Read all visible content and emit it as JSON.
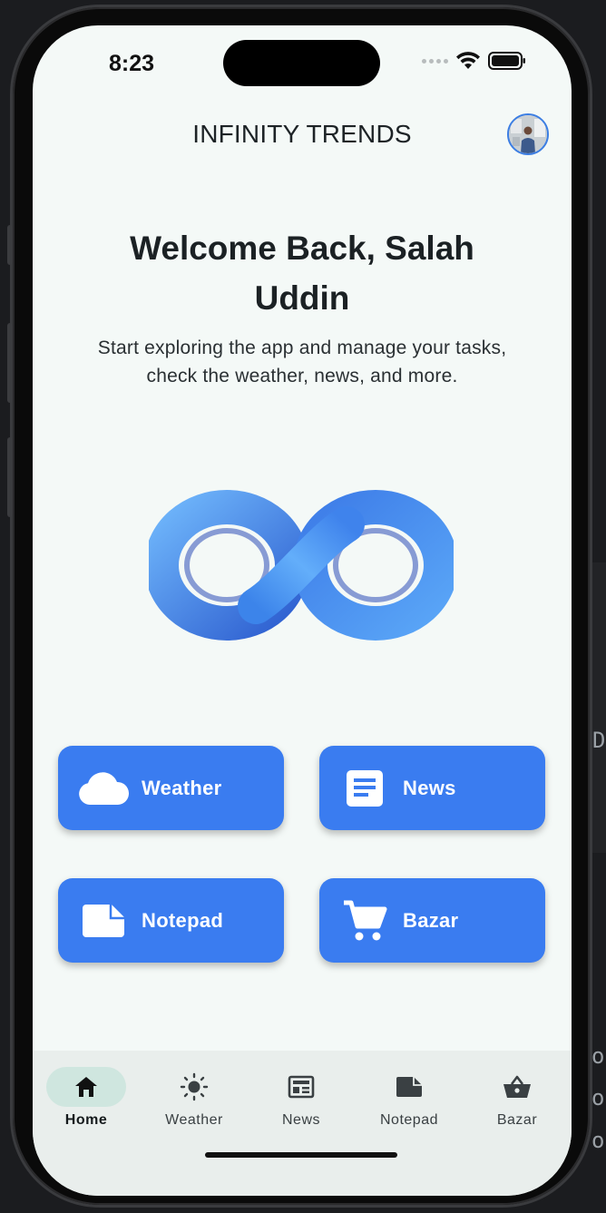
{
  "status": {
    "time": "8:23"
  },
  "appbar": {
    "title": "INFINITY TRENDS"
  },
  "welcome": {
    "line1": "Welcome Back, Salah",
    "line2": "Uddin",
    "subtitle_line1": "Start exploring the app and manage your tasks,",
    "subtitle_line2": "check the weather, news, and more."
  },
  "tiles": [
    {
      "label": "Weather",
      "icon": "cloud-icon"
    },
    {
      "label": "News",
      "icon": "article-icon"
    },
    {
      "label": "Notepad",
      "icon": "note-icon"
    },
    {
      "label": "Bazar",
      "icon": "cart-icon"
    }
  ],
  "nav": [
    {
      "label": "Home",
      "icon": "home-icon",
      "active": true
    },
    {
      "label": "Weather",
      "icon": "sun-icon",
      "active": false
    },
    {
      "label": "News",
      "icon": "newspaper-icon",
      "active": false
    },
    {
      "label": "Notepad",
      "icon": "note-icon",
      "active": false
    },
    {
      "label": "Bazar",
      "icon": "basket-icon",
      "active": false
    }
  ],
  "background_fragments": {
    "d": "D",
    "o1": "o",
    "o2": "o",
    "o3": "o"
  },
  "colors": {
    "accent": "#3a7cf0",
    "screen_bg": "#f4f9f7",
    "nav_active": "#cfe6df"
  }
}
